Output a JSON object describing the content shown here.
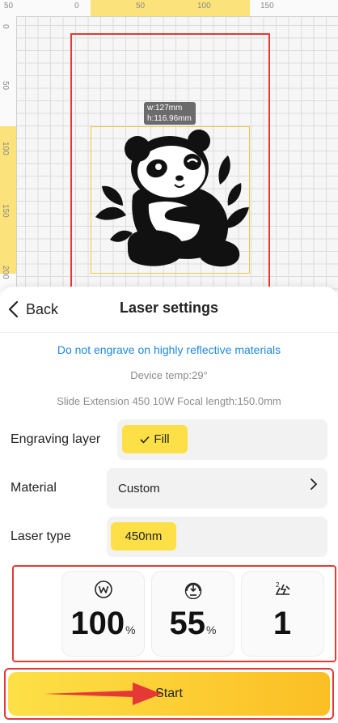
{
  "canvas": {
    "ruler_top_labels": [
      "50",
      "0",
      "50",
      "100",
      "150"
    ],
    "ruler_left_labels": [
      "0",
      "50",
      "100",
      "150",
      "200"
    ],
    "size_tip": {
      "width": "w:127mm",
      "height": "h:116.96mm"
    }
  },
  "header": {
    "back_label": "Back",
    "title": "Laser settings"
  },
  "warning": "Do not engrave on highly reflective materials",
  "device_temp": "Device temp:29°",
  "device_info": "Slide Extension 450 10W Focal length:150.0mm",
  "engraving_layer": {
    "label": "Engraving layer",
    "value": "Fill"
  },
  "material": {
    "label": "Material",
    "value": "Custom"
  },
  "laser_type": {
    "label": "Laser type",
    "value": "450nm"
  },
  "params": {
    "power": {
      "icon": "power-w-icon",
      "value": "100",
      "unit": "%"
    },
    "speed": {
      "icon": "speed-gauge-icon",
      "value": "55",
      "unit": "%"
    },
    "passes": {
      "icon": "passes-icon",
      "value": "1",
      "unit": ""
    }
  },
  "start_label": "Start",
  "colors": {
    "accent_yellow": "#fde047",
    "highlight_red": "#e53935",
    "link_blue": "#1e88e5"
  }
}
